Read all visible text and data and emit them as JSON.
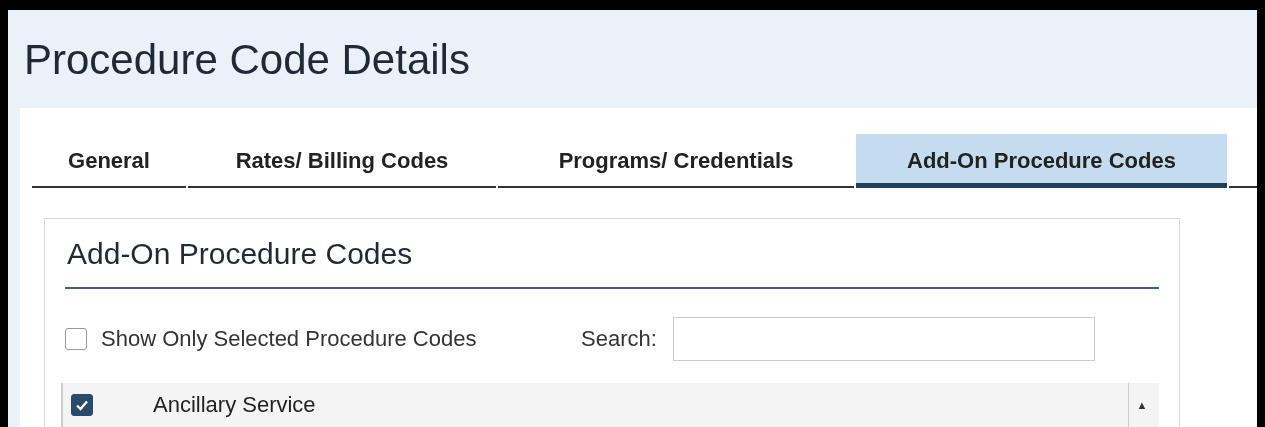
{
  "page": {
    "title": "Procedure Code Details"
  },
  "tabs": [
    {
      "label": "General",
      "selected": false
    },
    {
      "label": "Rates/ Billing Codes",
      "selected": false
    },
    {
      "label": "Programs/ Credentials",
      "selected": false
    },
    {
      "label": "Add-On Procedure Codes",
      "selected": true
    }
  ],
  "section": {
    "title": "Add-On Procedure Codes",
    "filter": {
      "label": "Show Only Selected Procedure Codes",
      "checked": false
    },
    "search": {
      "label": "Search:"
    },
    "rows": [
      {
        "name": "Ancillary Service",
        "checked": true
      }
    ],
    "scroll_up": "▲"
  }
}
